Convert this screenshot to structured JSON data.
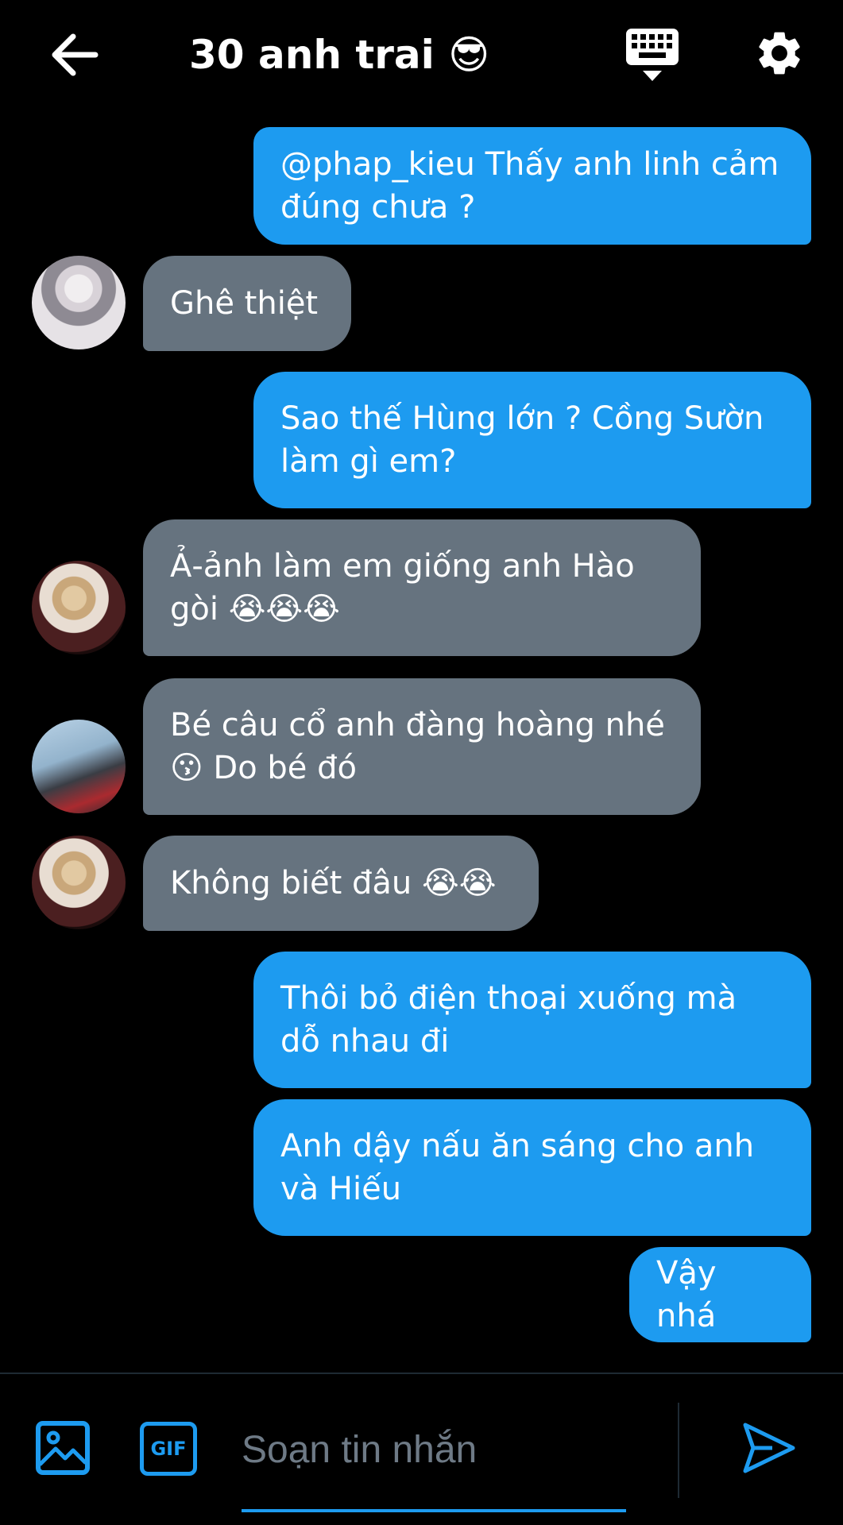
{
  "header": {
    "title": "30 anh trai 😎"
  },
  "messages": [
    {
      "side": "out",
      "text": "@phap_kieu Thấy anh linh cảm đúng chưa ?"
    },
    {
      "side": "in",
      "text": "Ghê thiệt"
    },
    {
      "side": "out",
      "text": "Sao thế Hùng lớn ? Cồng Sườn làm gì em?"
    },
    {
      "side": "in",
      "text": "Ả-ảnh làm em giống anh Hào gòi 😭😭😭"
    },
    {
      "side": "in",
      "text": "Bé câu cổ anh đàng hoàng nhé 😗 Do bé đó"
    },
    {
      "side": "in",
      "text": "Không biết đâu 😭😭"
    },
    {
      "side": "out",
      "text": "Thôi bỏ điện thoại xuống mà dỗ nhau đi"
    },
    {
      "side": "out",
      "text": "Anh dậy nấu ăn sáng cho anh và Hiếu"
    },
    {
      "side": "out",
      "text": "Vậy nhá"
    }
  ],
  "composer": {
    "gif_label": "GIF",
    "placeholder": "Soạn tin nhắn",
    "value": ""
  },
  "colors": {
    "accent": "#1d9bf0",
    "incoming_bubble": "#66737f",
    "background": "#000000"
  },
  "icons": [
    "back-arrow-icon",
    "keyboard-icon",
    "gear-icon",
    "image-icon",
    "gif-icon",
    "send-icon"
  ]
}
